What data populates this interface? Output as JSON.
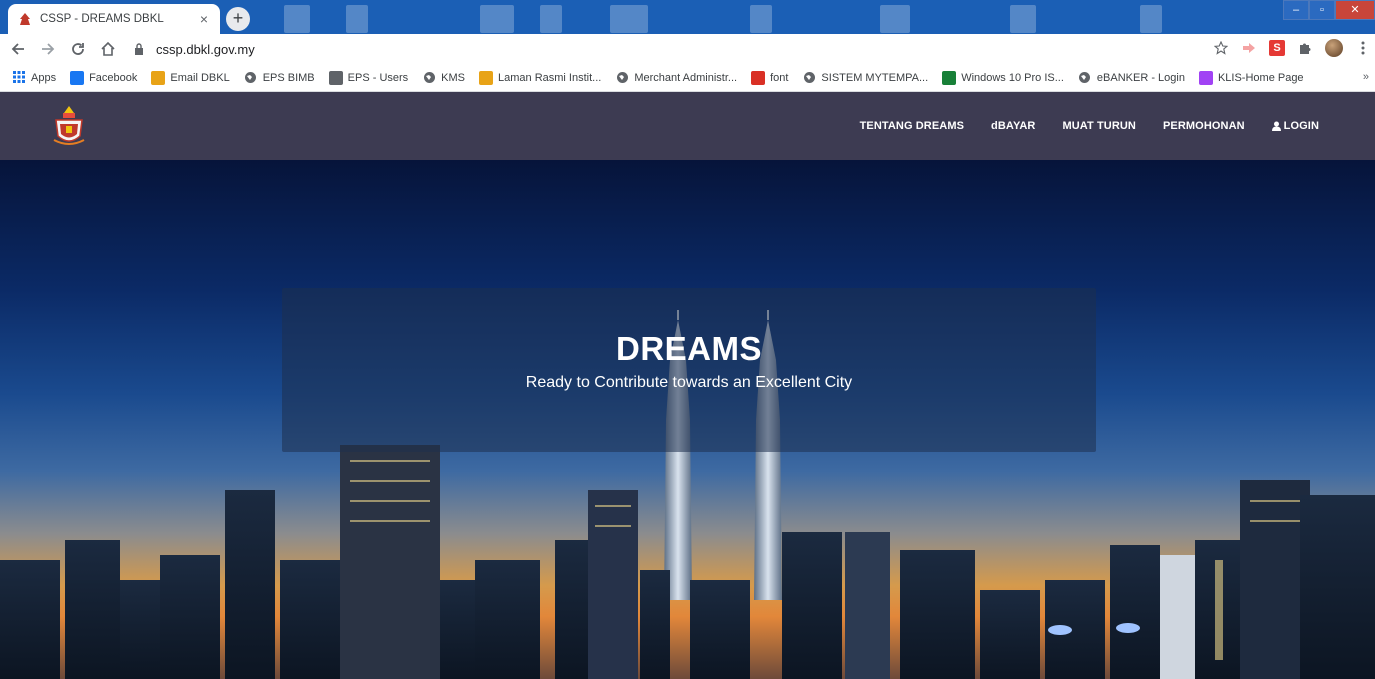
{
  "browser": {
    "tab": {
      "title": "CSSP - DREAMS DBKL",
      "close": "×"
    },
    "new_tab": "+",
    "url": "cssp.dbkl.gov.my",
    "window_controls": {
      "minimize": "–",
      "maximize": "▫",
      "close": "✕"
    },
    "extension_s": "S"
  },
  "bookmarks": [
    {
      "label": "Apps",
      "icon": "apps-grid-icon",
      "color": "#1a73e8"
    },
    {
      "label": "Facebook",
      "icon": "facebook-icon",
      "color": "#1877f2"
    },
    {
      "label": "Email DBKL",
      "icon": "outlook-icon",
      "color": "#e8a317"
    },
    {
      "label": "EPS BIMB",
      "icon": "globe-icon",
      "color": "#5f6368"
    },
    {
      "label": "EPS - Users",
      "icon": "eps-icon",
      "color": "#5f6368"
    },
    {
      "label": "KMS",
      "icon": "globe-icon",
      "color": "#5f6368"
    },
    {
      "label": "Laman Rasmi Instit...",
      "icon": "institute-icon",
      "color": "#e8a317"
    },
    {
      "label": "Merchant Administr...",
      "icon": "globe-icon",
      "color": "#5f6368"
    },
    {
      "label": "font",
      "icon": "font-icon",
      "color": "#d93025"
    },
    {
      "label": "SISTEM MYTEMPA...",
      "icon": "globe-icon",
      "color": "#5f6368"
    },
    {
      "label": "Windows 10 Pro IS...",
      "icon": "g-icon",
      "color": "#188038"
    },
    {
      "label": "eBANKER - Login",
      "icon": "globe-icon",
      "color": "#5f6368"
    },
    {
      "label": "KLIS-Home Page",
      "icon": "klis-icon",
      "color": "#a142f4"
    }
  ],
  "bookmarks_more": "»",
  "site": {
    "nav": [
      {
        "label": "TENTANG DREAMS"
      },
      {
        "label": "dBAYAR"
      },
      {
        "label": "MUAT TURUN"
      },
      {
        "label": "PERMOHONAN"
      },
      {
        "label": "LOGIN",
        "icon": "user-icon"
      }
    ],
    "hero": {
      "title": "DREAMS",
      "subtitle": "Ready to Contribute towards an Excellent City"
    },
    "colors": {
      "nav_bg": "#3d3b52",
      "text": "#ffffff"
    }
  }
}
